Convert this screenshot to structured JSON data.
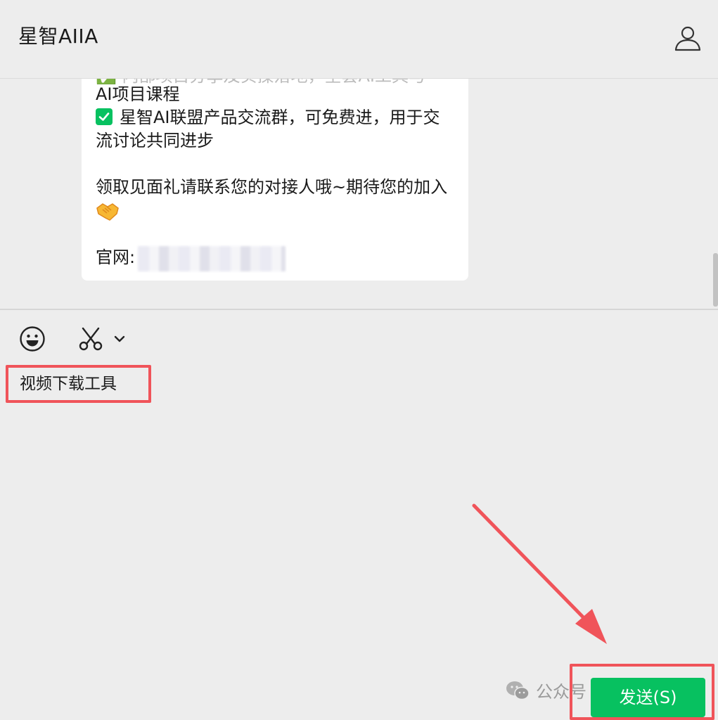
{
  "header": {
    "title": "星智AIIA"
  },
  "message": {
    "clipped_top_line": "✅ 内部项目分享及实操落地，全套AI工具与",
    "line1": "AI项目课程",
    "line2": "星智AI联盟产品交流群，可免费进，用于交",
    "line3": "流讨论共同进步",
    "line4": "领取见面礼请联系您的对接人哦~期待您的加入",
    "emoji": "🤝",
    "site_label": "官网:"
  },
  "composer": {
    "input_value": "视频下载工具",
    "send_label": "发送(S)"
  },
  "watermark": {
    "text": "公众号 · 星智AIIA"
  },
  "colors": {
    "accent": "#07c160",
    "highlight": "#f0545a",
    "background": "#ededed"
  },
  "icons": {
    "profile": "person-outline-icon",
    "emoji": "smiley-face-icon",
    "screenshot": "scissors-icon",
    "dropdown": "chevron-down-icon",
    "check": "green-checkbox-icon"
  }
}
